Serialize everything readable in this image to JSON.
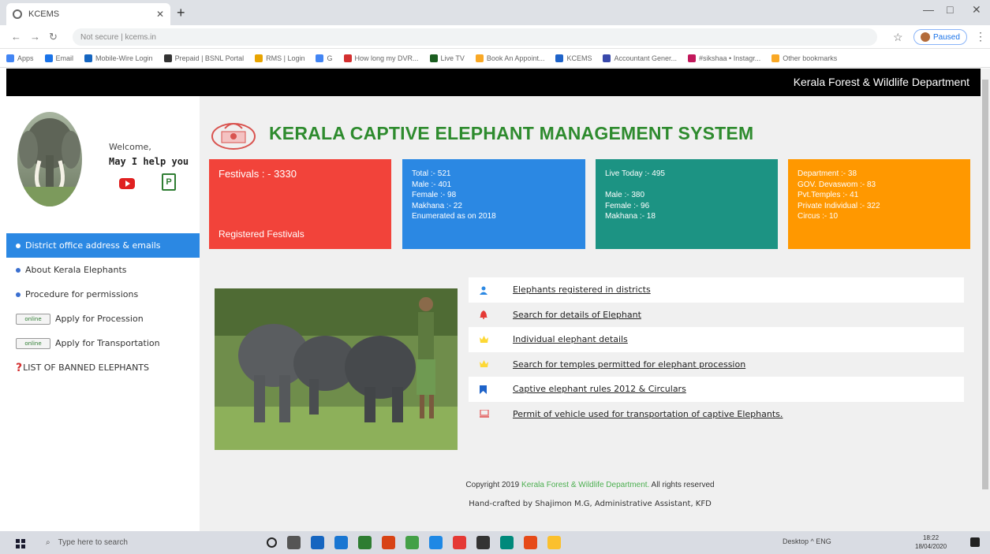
{
  "browser": {
    "tab_title": "KCEMS",
    "address": "Not secure | kcems.in",
    "profile_label": "Paused",
    "bookmarks": [
      "Apps",
      "Email",
      "Mobile-Wire Login",
      "Prepaid | BSNL Portal",
      "RMS | Login",
      "G",
      "How long my DVR...",
      "Live TV",
      "Book An Appoint...",
      "KCEMS",
      "Accountant Gener...",
      "#sikshaa • Instagr...",
      "Other bookmarks"
    ]
  },
  "header": {
    "department": "Kerala Forest & Wildlife Department"
  },
  "sidebar": {
    "welcome": "Welcome,",
    "help": "May I help you",
    "pdf_label": "P",
    "menu": [
      {
        "label": "District office address & emails",
        "type": "dot",
        "active": true
      },
      {
        "label": "About Kerala Elephants",
        "type": "dot"
      },
      {
        "label": "Procedure for permissions",
        "type": "dot"
      },
      {
        "label": "Apply for Procession",
        "type": "online"
      },
      {
        "label": "Apply for Transportation",
        "type": "online"
      },
      {
        "label": "LIST OF BANNED ELEPHANTS",
        "type": "question"
      }
    ],
    "online_badge": "online"
  },
  "main": {
    "title": "KERALA CAPTIVE ELEPHANT MANAGEMENT SYSTEM",
    "cards": [
      {
        "lines": [
          "Festivals : - 3330"
        ],
        "footer": "Registered Festivals",
        "color": "#f2433a"
      },
      {
        "lines": [
          "Total :- 521",
          "Male :- 401",
          "Female :- 98",
          "Makhana :- 22",
          "Enumerated as on 2018"
        ],
        "color": "#2b88e3"
      },
      {
        "lines": [
          "Live Today :- 495",
          "",
          "Male :- 380",
          "Female :- 96",
          "Makhana :- 18"
        ],
        "color": "#1c9383"
      },
      {
        "lines": [
          "Department :- 38",
          "GOV. Devaswom :- 83",
          "Pvt.Temples :- 41",
          "Private Individual :- 322",
          "Circus :- 10"
        ],
        "color": "#ff9800"
      }
    ],
    "links": [
      {
        "label": "Elephants registered in districts",
        "icon": "user-icon",
        "color": "#2b88e3"
      },
      {
        "label": "Search for details of Elephant",
        "icon": "bell-icon",
        "color": "#e53935"
      },
      {
        "label": "Individual elephant details",
        "icon": "crown-icon",
        "color": "#fdd835"
      },
      {
        "label": "Search for temples permitted for elephant procession",
        "icon": "crown-icon",
        "color": "#fdd835"
      },
      {
        "label": "Captive elephant rules 2012 & Circulars",
        "icon": "bookmark-icon",
        "color": "#1e63c9"
      },
      {
        "label": "Permit of vehicle used for transportation of captive Elephants.",
        "icon": "laptop-icon",
        "color": "#e57373"
      }
    ]
  },
  "footer": {
    "copy_prefix": "Copyright 2019",
    "copy_link": "Kerala Forest & Wildlife Department.",
    "copy_suffix": "All rights reserved",
    "credit": "Hand-crafted by Shajimon M.G, Administrative Assistant, KFD"
  },
  "taskbar": {
    "search_placeholder": "Type here to search",
    "tray": "Desktop  ^  ENG",
    "time": "18:22",
    "date": "18/04/2020"
  }
}
